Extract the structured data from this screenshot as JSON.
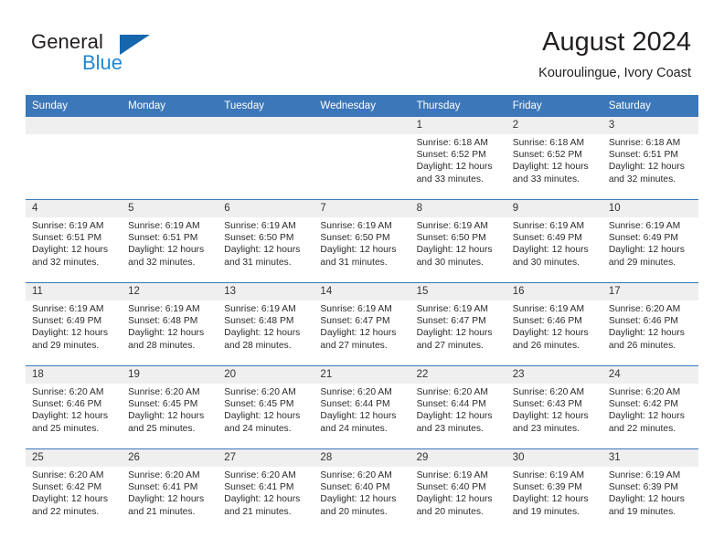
{
  "brand": {
    "name_part1": "General",
    "name_part2": "Blue"
  },
  "header": {
    "title": "August 2024",
    "subtitle": "Kouroulingue, Ivory Coast"
  },
  "weekday_headers": [
    "Sunday",
    "Monday",
    "Tuesday",
    "Wednesday",
    "Thursday",
    "Friday",
    "Saturday"
  ],
  "labels": {
    "sunrise_prefix": "Sunrise:",
    "sunset_prefix": "Sunset:",
    "daylight_prefix": "Daylight:"
  },
  "weeks": [
    [
      {
        "empty": true
      },
      {
        "empty": true
      },
      {
        "empty": true
      },
      {
        "empty": true
      },
      {
        "day": "1",
        "line1": "Sunrise: 6:18 AM",
        "line2": "Sunset: 6:52 PM",
        "line3": "Daylight: 12 hours",
        "line4": "and 33 minutes."
      },
      {
        "day": "2",
        "line1": "Sunrise: 6:18 AM",
        "line2": "Sunset: 6:52 PM",
        "line3": "Daylight: 12 hours",
        "line4": "and 33 minutes."
      },
      {
        "day": "3",
        "line1": "Sunrise: 6:18 AM",
        "line2": "Sunset: 6:51 PM",
        "line3": "Daylight: 12 hours",
        "line4": "and 32 minutes."
      }
    ],
    [
      {
        "day": "4",
        "line1": "Sunrise: 6:19 AM",
        "line2": "Sunset: 6:51 PM",
        "line3": "Daylight: 12 hours",
        "line4": "and 32 minutes."
      },
      {
        "day": "5",
        "line1": "Sunrise: 6:19 AM",
        "line2": "Sunset: 6:51 PM",
        "line3": "Daylight: 12 hours",
        "line4": "and 32 minutes."
      },
      {
        "day": "6",
        "line1": "Sunrise: 6:19 AM",
        "line2": "Sunset: 6:50 PM",
        "line3": "Daylight: 12 hours",
        "line4": "and 31 minutes."
      },
      {
        "day": "7",
        "line1": "Sunrise: 6:19 AM",
        "line2": "Sunset: 6:50 PM",
        "line3": "Daylight: 12 hours",
        "line4": "and 31 minutes."
      },
      {
        "day": "8",
        "line1": "Sunrise: 6:19 AM",
        "line2": "Sunset: 6:50 PM",
        "line3": "Daylight: 12 hours",
        "line4": "and 30 minutes."
      },
      {
        "day": "9",
        "line1": "Sunrise: 6:19 AM",
        "line2": "Sunset: 6:49 PM",
        "line3": "Daylight: 12 hours",
        "line4": "and 30 minutes."
      },
      {
        "day": "10",
        "line1": "Sunrise: 6:19 AM",
        "line2": "Sunset: 6:49 PM",
        "line3": "Daylight: 12 hours",
        "line4": "and 29 minutes."
      }
    ],
    [
      {
        "day": "11",
        "line1": "Sunrise: 6:19 AM",
        "line2": "Sunset: 6:49 PM",
        "line3": "Daylight: 12 hours",
        "line4": "and 29 minutes."
      },
      {
        "day": "12",
        "line1": "Sunrise: 6:19 AM",
        "line2": "Sunset: 6:48 PM",
        "line3": "Daylight: 12 hours",
        "line4": "and 28 minutes."
      },
      {
        "day": "13",
        "line1": "Sunrise: 6:19 AM",
        "line2": "Sunset: 6:48 PM",
        "line3": "Daylight: 12 hours",
        "line4": "and 28 minutes."
      },
      {
        "day": "14",
        "line1": "Sunrise: 6:19 AM",
        "line2": "Sunset: 6:47 PM",
        "line3": "Daylight: 12 hours",
        "line4": "and 27 minutes."
      },
      {
        "day": "15",
        "line1": "Sunrise: 6:19 AM",
        "line2": "Sunset: 6:47 PM",
        "line3": "Daylight: 12 hours",
        "line4": "and 27 minutes."
      },
      {
        "day": "16",
        "line1": "Sunrise: 6:19 AM",
        "line2": "Sunset: 6:46 PM",
        "line3": "Daylight: 12 hours",
        "line4": "and 26 minutes."
      },
      {
        "day": "17",
        "line1": "Sunrise: 6:20 AM",
        "line2": "Sunset: 6:46 PM",
        "line3": "Daylight: 12 hours",
        "line4": "and 26 minutes."
      }
    ],
    [
      {
        "day": "18",
        "line1": "Sunrise: 6:20 AM",
        "line2": "Sunset: 6:46 PM",
        "line3": "Daylight: 12 hours",
        "line4": "and 25 minutes."
      },
      {
        "day": "19",
        "line1": "Sunrise: 6:20 AM",
        "line2": "Sunset: 6:45 PM",
        "line3": "Daylight: 12 hours",
        "line4": "and 25 minutes."
      },
      {
        "day": "20",
        "line1": "Sunrise: 6:20 AM",
        "line2": "Sunset: 6:45 PM",
        "line3": "Daylight: 12 hours",
        "line4": "and 24 minutes."
      },
      {
        "day": "21",
        "line1": "Sunrise: 6:20 AM",
        "line2": "Sunset: 6:44 PM",
        "line3": "Daylight: 12 hours",
        "line4": "and 24 minutes."
      },
      {
        "day": "22",
        "line1": "Sunrise: 6:20 AM",
        "line2": "Sunset: 6:44 PM",
        "line3": "Daylight: 12 hours",
        "line4": "and 23 minutes."
      },
      {
        "day": "23",
        "line1": "Sunrise: 6:20 AM",
        "line2": "Sunset: 6:43 PM",
        "line3": "Daylight: 12 hours",
        "line4": "and 23 minutes."
      },
      {
        "day": "24",
        "line1": "Sunrise: 6:20 AM",
        "line2": "Sunset: 6:42 PM",
        "line3": "Daylight: 12 hours",
        "line4": "and 22 minutes."
      }
    ],
    [
      {
        "day": "25",
        "line1": "Sunrise: 6:20 AM",
        "line2": "Sunset: 6:42 PM",
        "line3": "Daylight: 12 hours",
        "line4": "and 22 minutes."
      },
      {
        "day": "26",
        "line1": "Sunrise: 6:20 AM",
        "line2": "Sunset: 6:41 PM",
        "line3": "Daylight: 12 hours",
        "line4": "and 21 minutes."
      },
      {
        "day": "27",
        "line1": "Sunrise: 6:20 AM",
        "line2": "Sunset: 6:41 PM",
        "line3": "Daylight: 12 hours",
        "line4": "and 21 minutes."
      },
      {
        "day": "28",
        "line1": "Sunrise: 6:20 AM",
        "line2": "Sunset: 6:40 PM",
        "line3": "Daylight: 12 hours",
        "line4": "and 20 minutes."
      },
      {
        "day": "29",
        "line1": "Sunrise: 6:19 AM",
        "line2": "Sunset: 6:40 PM",
        "line3": "Daylight: 12 hours",
        "line4": "and 20 minutes."
      },
      {
        "day": "30",
        "line1": "Sunrise: 6:19 AM",
        "line2": "Sunset: 6:39 PM",
        "line3": "Daylight: 12 hours",
        "line4": "and 19 minutes."
      },
      {
        "day": "31",
        "line1": "Sunrise: 6:19 AM",
        "line2": "Sunset: 6:39 PM",
        "line3": "Daylight: 12 hours",
        "line4": "and 19 minutes."
      }
    ]
  ],
  "colors": {
    "header_blue": "#3b77b9",
    "brand_blue": "#2287d4",
    "logo_triangle_blue": "#1566ad",
    "daynum_band": "#efefef",
    "text": "#231f20"
  }
}
